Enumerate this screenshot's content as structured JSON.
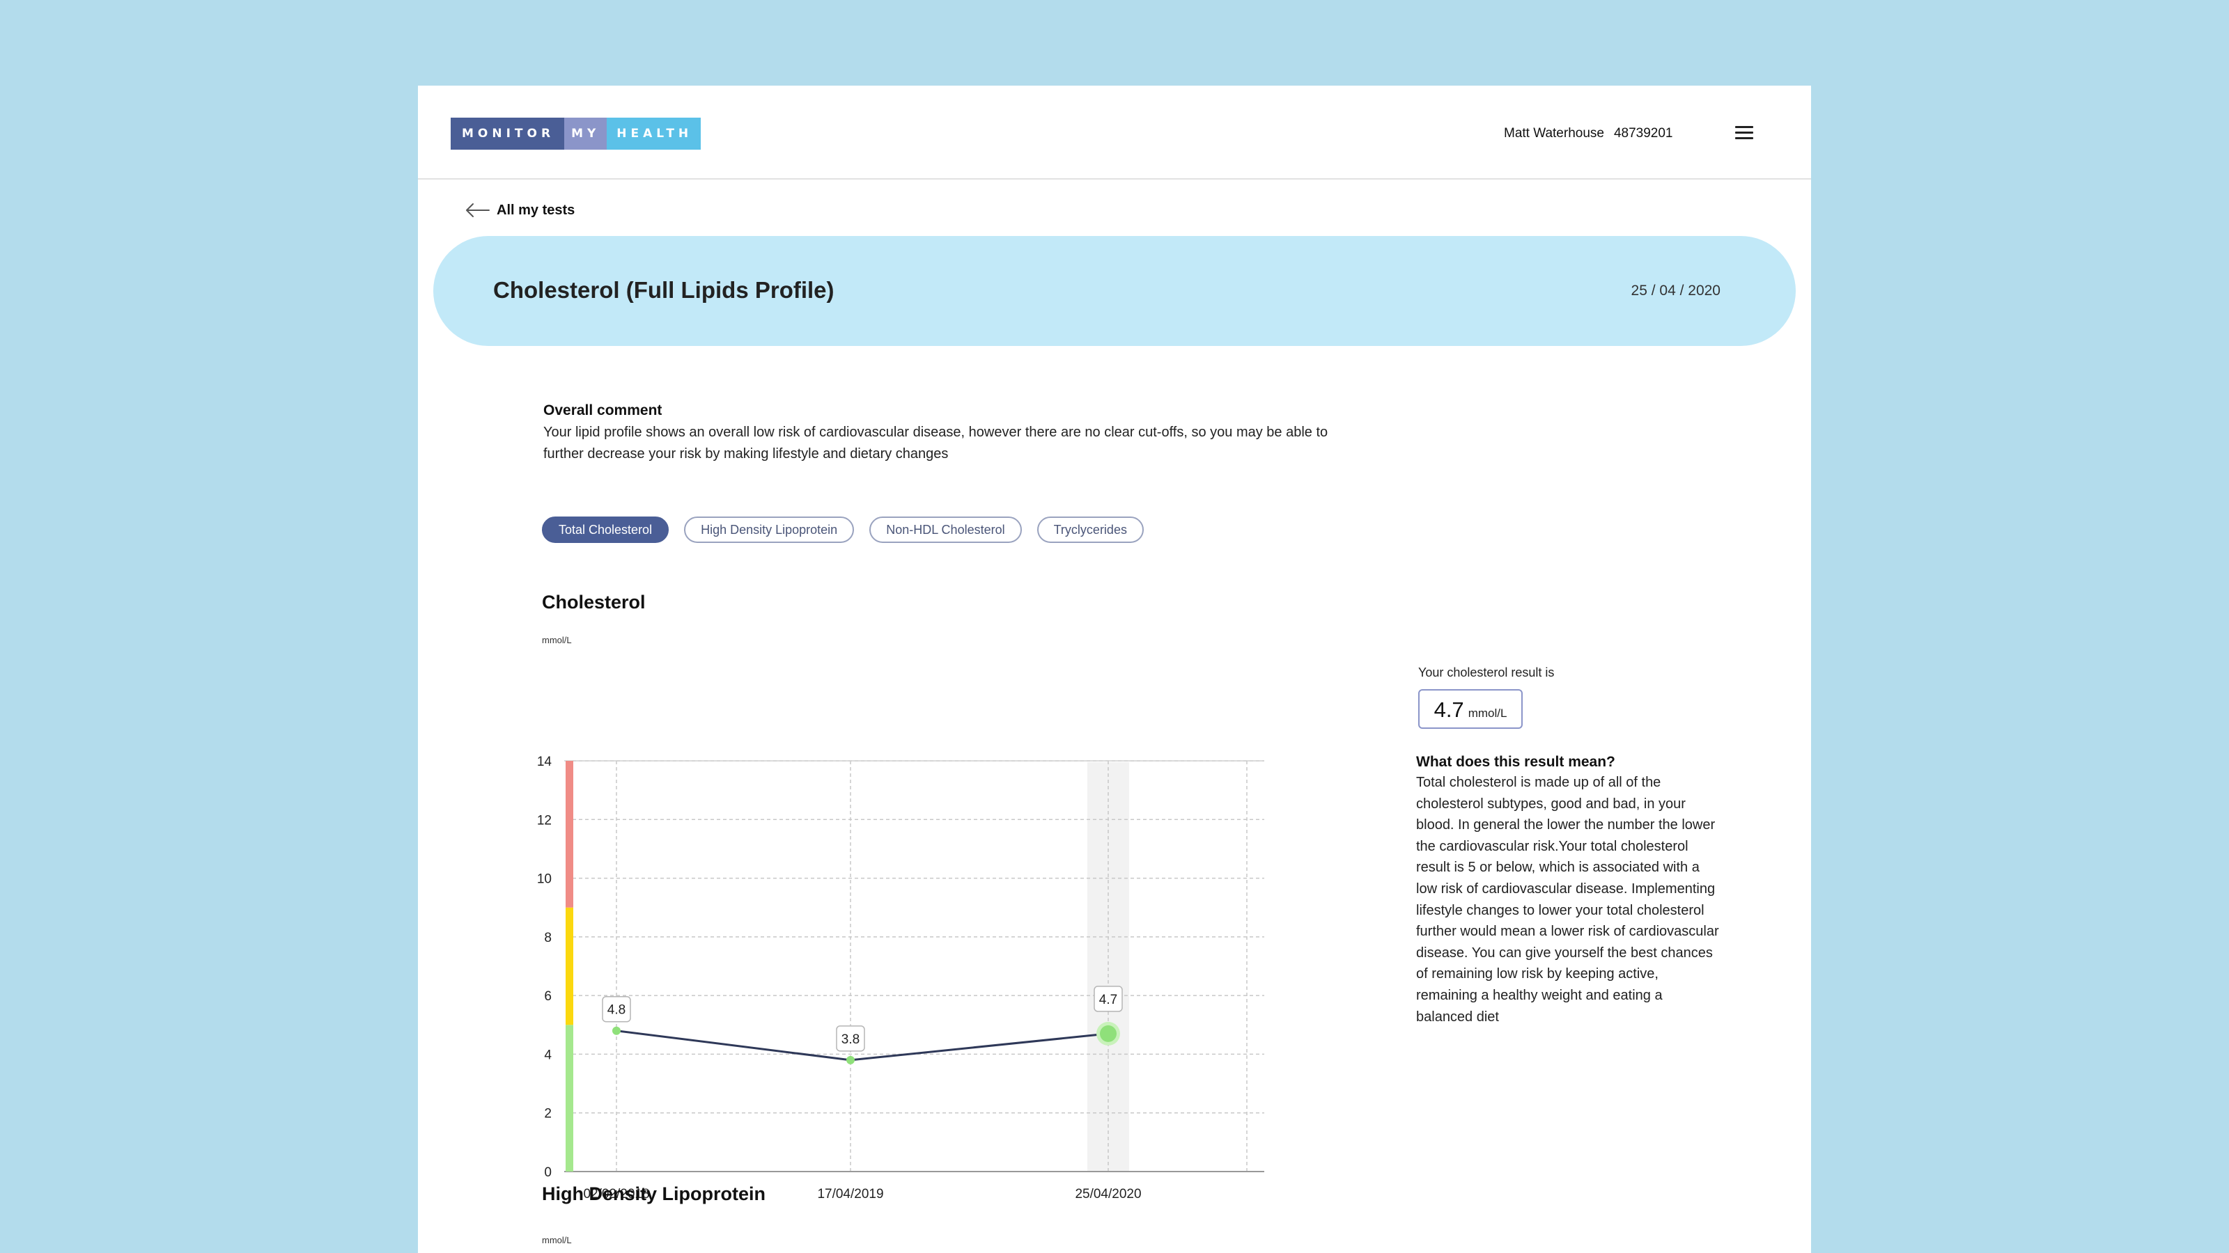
{
  "header": {
    "logo": {
      "part1": "MONITOR",
      "part2": "MY",
      "part3": "HEALTH"
    },
    "user_name": "Matt Waterhouse",
    "user_id": "48739201",
    "menu_icon": "hamburger-menu-icon"
  },
  "back_link": {
    "label": "All my tests",
    "icon": "arrow-left-icon"
  },
  "test": {
    "title": "Cholesterol (Full Lipids Profile)",
    "date": "25 / 04 / 2020"
  },
  "comment": {
    "heading": "Overall comment",
    "text": "Your lipid profile shows an overall low risk of cardiovascular disease, however there are no clear cut-offs, so you may be able to further decrease your risk by making lifestyle and dietary changes"
  },
  "tabs": [
    {
      "label": "Total Cholesterol",
      "active": true
    },
    {
      "label": "High Density Lipoprotein",
      "active": false
    },
    {
      "label": "Non-HDL Cholesterol",
      "active": false
    },
    {
      "label": "Tryclycerides",
      "active": false
    }
  ],
  "section1": {
    "title": "Cholesterol",
    "unit": "mmol/L"
  },
  "section2": {
    "title": "High Density Lipoprotein",
    "unit": "mmol/L"
  },
  "result": {
    "label": "Your cholesterol result is",
    "value": "4.7",
    "unit": "mmol/L",
    "meaning_heading": "What does this result mean?",
    "meaning_text": "Total cholesterol is made up of all of the cholesterol subtypes, good and bad, in your blood. In general the lower the number the lower the cardiovascular risk.Your total cholesterol result is 5 or below, which is associated with a low risk of cardiovascular disease. Implementing lifestyle changes to lower your total cholesterol further would mean a lower risk of cardiovascular disease. You can give yourself the best chances of remaining low risk by keeping active, remaining a healthy weight and eating a balanced diet"
  },
  "chart_data": {
    "type": "line",
    "title": "Cholesterol",
    "xlabel": "",
    "ylabel": "mmol/L",
    "ylim": [
      0,
      14
    ],
    "yticks": [
      0,
      2,
      4,
      6,
      8,
      10,
      12,
      14
    ],
    "categories": [
      "02/02/2018",
      "17/04/2019",
      "25/04/2020"
    ],
    "values": [
      4.8,
      3.8,
      4.7
    ],
    "data_labels": [
      "4.8",
      "3.8",
      "4.7"
    ],
    "highlighted_index": 2,
    "grid": true,
    "risk_bands": [
      {
        "from": 0,
        "to": 5,
        "color": "#a5e88e"
      },
      {
        "from": 5,
        "to": 9,
        "color": "#fbd80f"
      },
      {
        "from": 9,
        "to": 14,
        "color": "#f08c86"
      }
    ],
    "line_color": "#2e3858",
    "point_color": "#8fe07a"
  }
}
